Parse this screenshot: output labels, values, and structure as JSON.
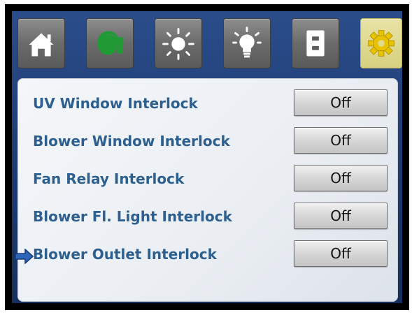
{
  "toolbar": {
    "buttons": [
      {
        "icon": "home-icon"
      },
      {
        "icon": "blower-icon"
      },
      {
        "icon": "uv-sun-icon"
      },
      {
        "icon": "light-bulb-icon"
      },
      {
        "icon": "outlet-icon"
      },
      {
        "icon": "gear-icon",
        "active": true
      }
    ]
  },
  "settings": {
    "rows": [
      {
        "label": "UV Window Interlock",
        "value": "Off"
      },
      {
        "label": "Blower Window Interlock",
        "value": "Off"
      },
      {
        "label": "Fan Relay Interlock",
        "value": "Off"
      },
      {
        "label": "Blower Fl. Light Interlock",
        "value": "Off"
      },
      {
        "label": "Blower Outlet Interlock",
        "value": "Off",
        "selected": true
      }
    ]
  },
  "colors": {
    "background": "#1d3a70",
    "label": "#2d5f8f",
    "active_tab": "#e1db8f",
    "blower_icon": "#1f9a35"
  }
}
